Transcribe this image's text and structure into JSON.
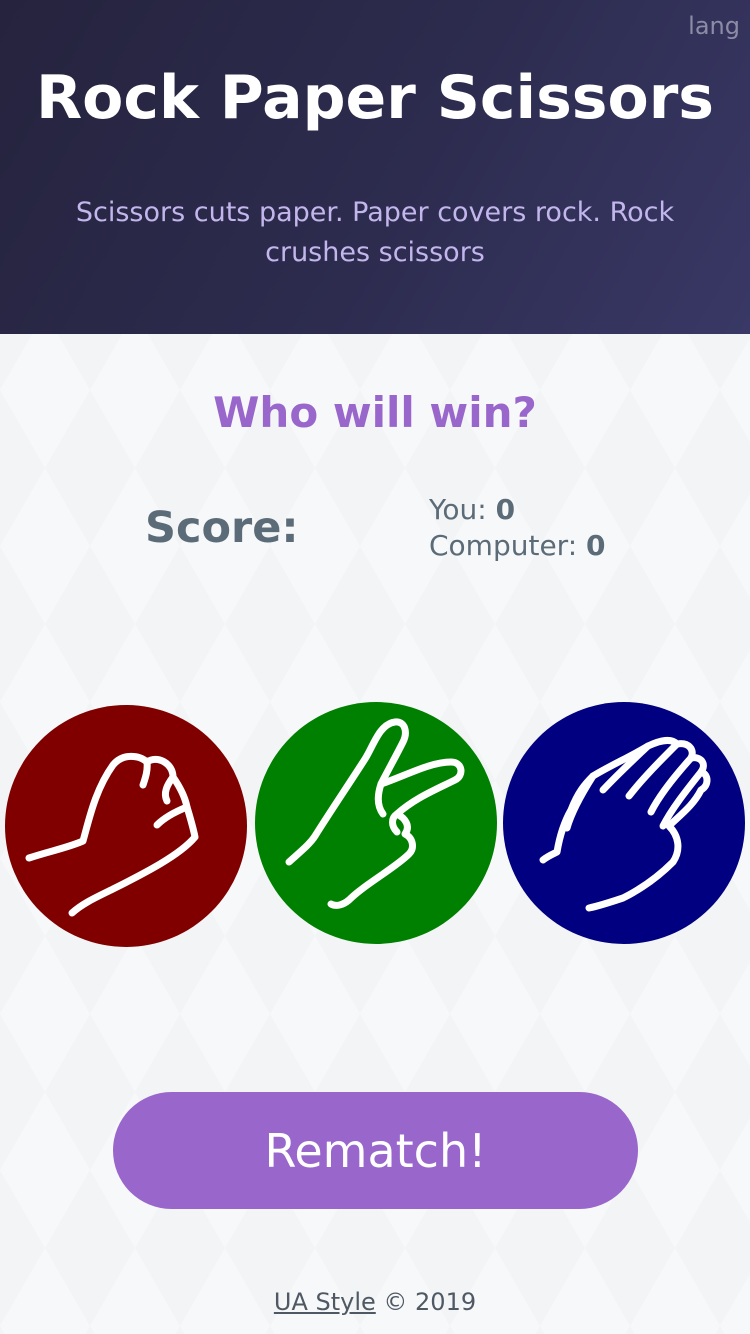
{
  "header": {
    "lang_label": "lang",
    "title": "Rock Paper Scissors",
    "subtitle": "Scissors cuts paper. Paper covers rock. Rock crushes scissors"
  },
  "game": {
    "question": "Who will win?",
    "score_label": "Score:",
    "you_label": "You:",
    "you_score": "0",
    "computer_label": "Computer:",
    "computer_score": "0",
    "choices": [
      {
        "name": "rock",
        "icon": "fist-icon",
        "color": "#800000"
      },
      {
        "name": "scissors",
        "icon": "victory-hand-icon",
        "color": "#008000"
      },
      {
        "name": "paper",
        "icon": "open-hand-icon",
        "color": "#000080"
      }
    ],
    "rematch_label": "Rematch!"
  },
  "footer": {
    "link_label": "UA Style",
    "copyright": " © 2019"
  },
  "colors": {
    "accent": "#9966cc",
    "header_bg": "#2d2c4f",
    "score_text": "#5c6b78"
  }
}
